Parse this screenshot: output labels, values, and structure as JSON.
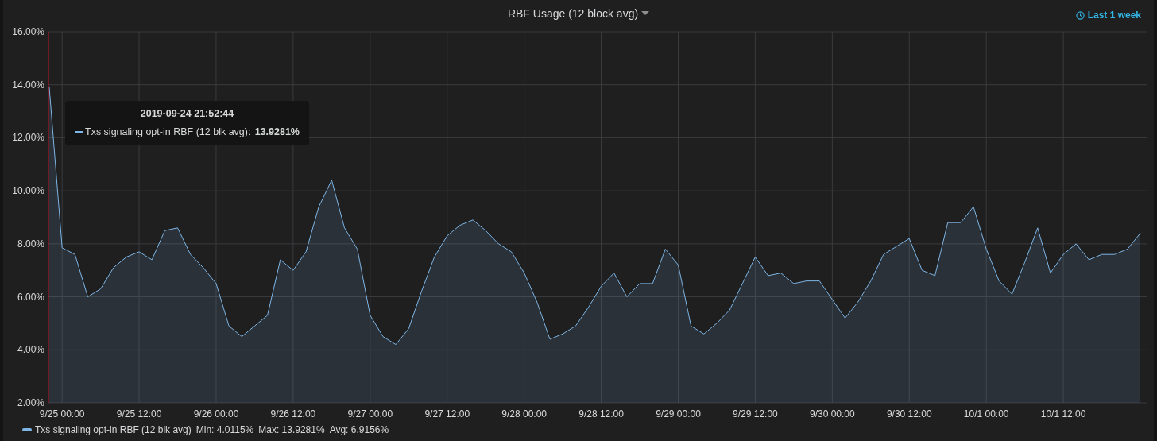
{
  "panel": {
    "title": "RBF Usage (12 block avg)",
    "time_range": "Last 1 week"
  },
  "chart_data": {
    "type": "area",
    "categories": [
      null,
      "9/25 00:00",
      null,
      null,
      null,
      null,
      null,
      "9/25 12:00",
      null,
      null,
      null,
      null,
      null,
      "9/26 00:00",
      null,
      null,
      null,
      null,
      null,
      "9/26 12:00",
      null,
      null,
      null,
      null,
      null,
      "9/27 00:00",
      null,
      null,
      null,
      null,
      null,
      "9/27 12:00",
      null,
      null,
      null,
      null,
      null,
      "9/28 00:00",
      null,
      null,
      null,
      null,
      null,
      "9/28 12:00",
      null,
      null,
      null,
      null,
      null,
      "9/29 00:00",
      null,
      null,
      null,
      null,
      null,
      "9/29 12:00",
      null,
      null,
      null,
      null,
      null,
      "9/30 00:00",
      null,
      null,
      null,
      null,
      null,
      "9/30 12:00",
      null,
      null,
      null,
      null,
      null,
      "10/1 00:00",
      null,
      null,
      null,
      null,
      null,
      "10/1 12:00",
      null,
      null,
      null,
      null,
      null,
      null
    ],
    "series": [
      {
        "name": "Txs signaling opt-in RBF (12 blk avg)",
        "color": "#7eb6e6",
        "values": [
          13.9,
          7.85,
          7.6,
          6.0,
          6.3,
          7.1,
          7.5,
          7.7,
          7.4,
          8.5,
          8.6,
          7.6,
          7.1,
          6.5,
          4.9,
          4.5,
          4.9,
          5.3,
          7.4,
          7.0,
          7.7,
          9.4,
          10.4,
          8.6,
          7.8,
          5.3,
          4.5,
          4.2,
          4.8,
          6.2,
          7.5,
          8.3,
          8.7,
          8.9,
          8.5,
          8.0,
          7.7,
          6.9,
          5.8,
          4.4,
          4.6,
          4.9,
          5.6,
          6.4,
          6.9,
          6.0,
          6.5,
          6.5,
          7.8,
          7.2,
          4.9,
          4.6,
          5.0,
          5.5,
          6.5,
          7.5,
          6.8,
          6.9,
          6.5,
          6.6,
          6.6,
          5.9,
          5.2,
          5.8,
          6.6,
          7.6,
          7.9,
          8.2,
          7.0,
          6.8,
          8.8,
          8.8,
          9.4,
          7.8,
          6.6,
          6.1,
          7.3,
          8.6,
          6.9,
          7.6,
          8.0,
          7.4,
          7.6,
          7.6,
          7.8,
          8.4
        ]
      }
    ],
    "ylim": [
      2,
      16
    ],
    "grid": true,
    "yticks": [
      {
        "value": 2,
        "label": "2.00%"
      },
      {
        "value": 4,
        "label": "4.00%"
      },
      {
        "value": 6,
        "label": "6.00%"
      },
      {
        "value": 8,
        "label": "8.00%"
      },
      {
        "value": 10,
        "label": "10.00%"
      },
      {
        "value": 12,
        "label": "12.00%"
      },
      {
        "value": 14,
        "label": "14.00%"
      },
      {
        "value": 16,
        "label": "16.00%"
      }
    ]
  },
  "tooltip": {
    "time": "2019-09-24 21:52:44",
    "label": "Txs signaling opt-in RBF (12 blk avg):",
    "value": "13.9281%"
  },
  "legend": {
    "min": "Min: 4.0115%",
    "max": "Max: 13.9281%",
    "avg": "Avg: 6.9156%"
  }
}
